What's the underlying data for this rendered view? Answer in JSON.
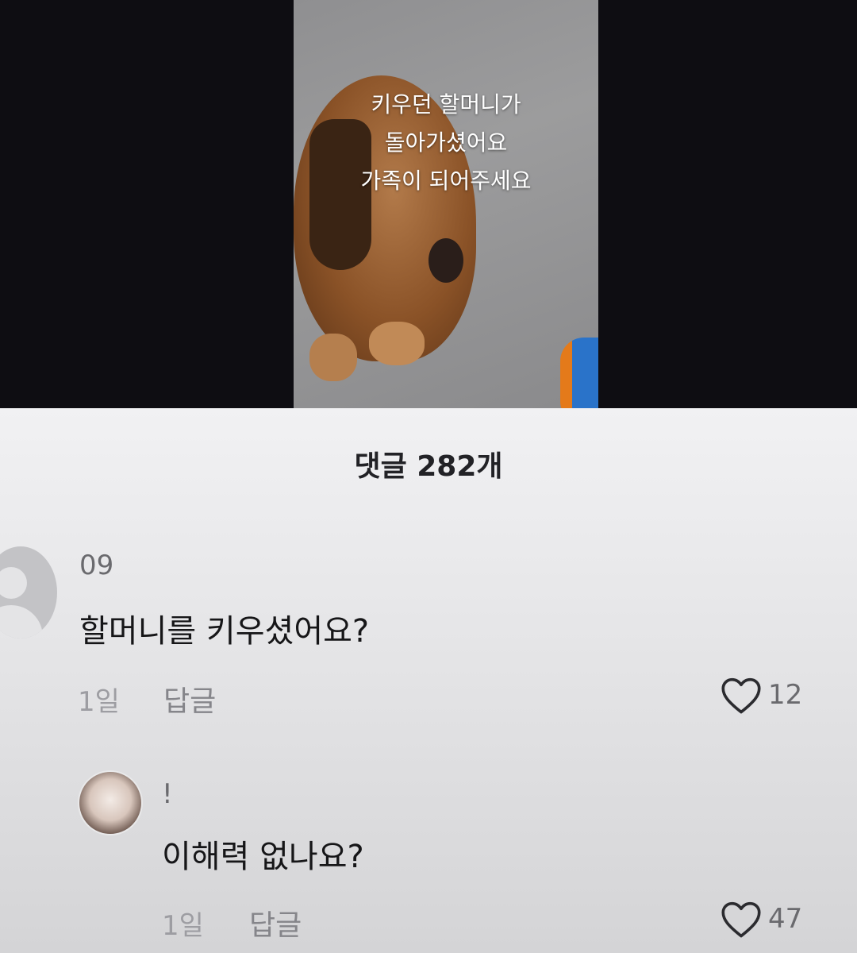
{
  "video": {
    "overlay_lines": [
      "키우던 할머니가",
      "돌아가셨어요",
      "가족이 되어주세요"
    ]
  },
  "comments_header": "댓글 282개",
  "comments": [
    {
      "username": "09",
      "text": "할머니를 키우셨어요?",
      "time": "1일",
      "reply_label": "답글",
      "likes": "12",
      "avatar_icon": "default-avatar-icon"
    },
    {
      "username": "!",
      "text": "이해력 없나요?",
      "time": "1일",
      "reply_label": "답글",
      "likes": "47",
      "avatar_icon": "user-photo-avatar"
    }
  ],
  "icons": {
    "like": "heart-outline-icon"
  },
  "colors": {
    "video_background": "#0e0d12",
    "panel_background": "#ececee",
    "text_primary": "#161618",
    "text_secondary": "#85858a"
  }
}
